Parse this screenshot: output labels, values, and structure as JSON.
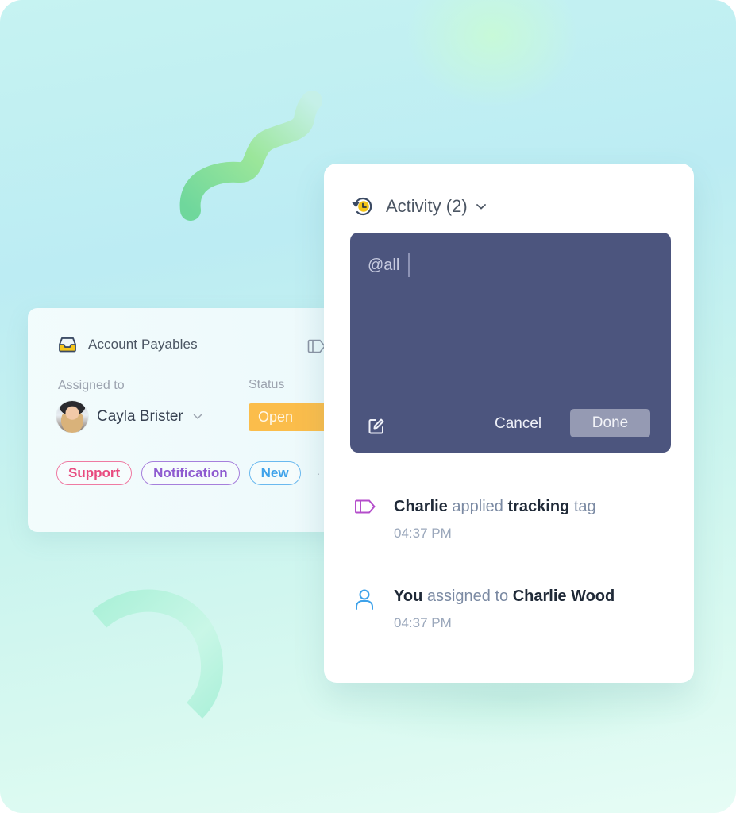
{
  "left_card": {
    "title": "Account Payables",
    "inbox_icon": "inbox-tray-icon",
    "panel_icon": "sidebar-panel-icon",
    "assigned_label": "Assigned to",
    "assignee_name": "Cayla Brister",
    "status_label": "Status",
    "status_value": "Open",
    "tags": [
      {
        "label": "Support",
        "color": "#e84b7f"
      },
      {
        "label": "Notification",
        "color": "#8e5bd0"
      },
      {
        "label": "New",
        "color": "#3ea2ea"
      }
    ],
    "more_indicator": "·"
  },
  "activity_card": {
    "title": "Activity (2)",
    "history_icon": "history-clock-icon",
    "composer": {
      "text": "@all",
      "cancel_label": "Cancel",
      "done_label": "Done",
      "background": "#4c557e"
    },
    "items": [
      {
        "icon": "tag-icon",
        "actor": "Charlie",
        "verb": "applied",
        "object": "tracking",
        "suffix": "tag",
        "time": "04:37 PM"
      },
      {
        "icon": "user-icon",
        "actor": "You",
        "verb": "assigned to",
        "object": "Charlie Wood",
        "suffix": "",
        "time": "04:37 PM"
      }
    ]
  },
  "colors": {
    "status_open": "#fbbd4b",
    "accent_yellow": "#f5c518",
    "tag_icon": "#b44ecb",
    "user_icon": "#3ea2ea"
  }
}
